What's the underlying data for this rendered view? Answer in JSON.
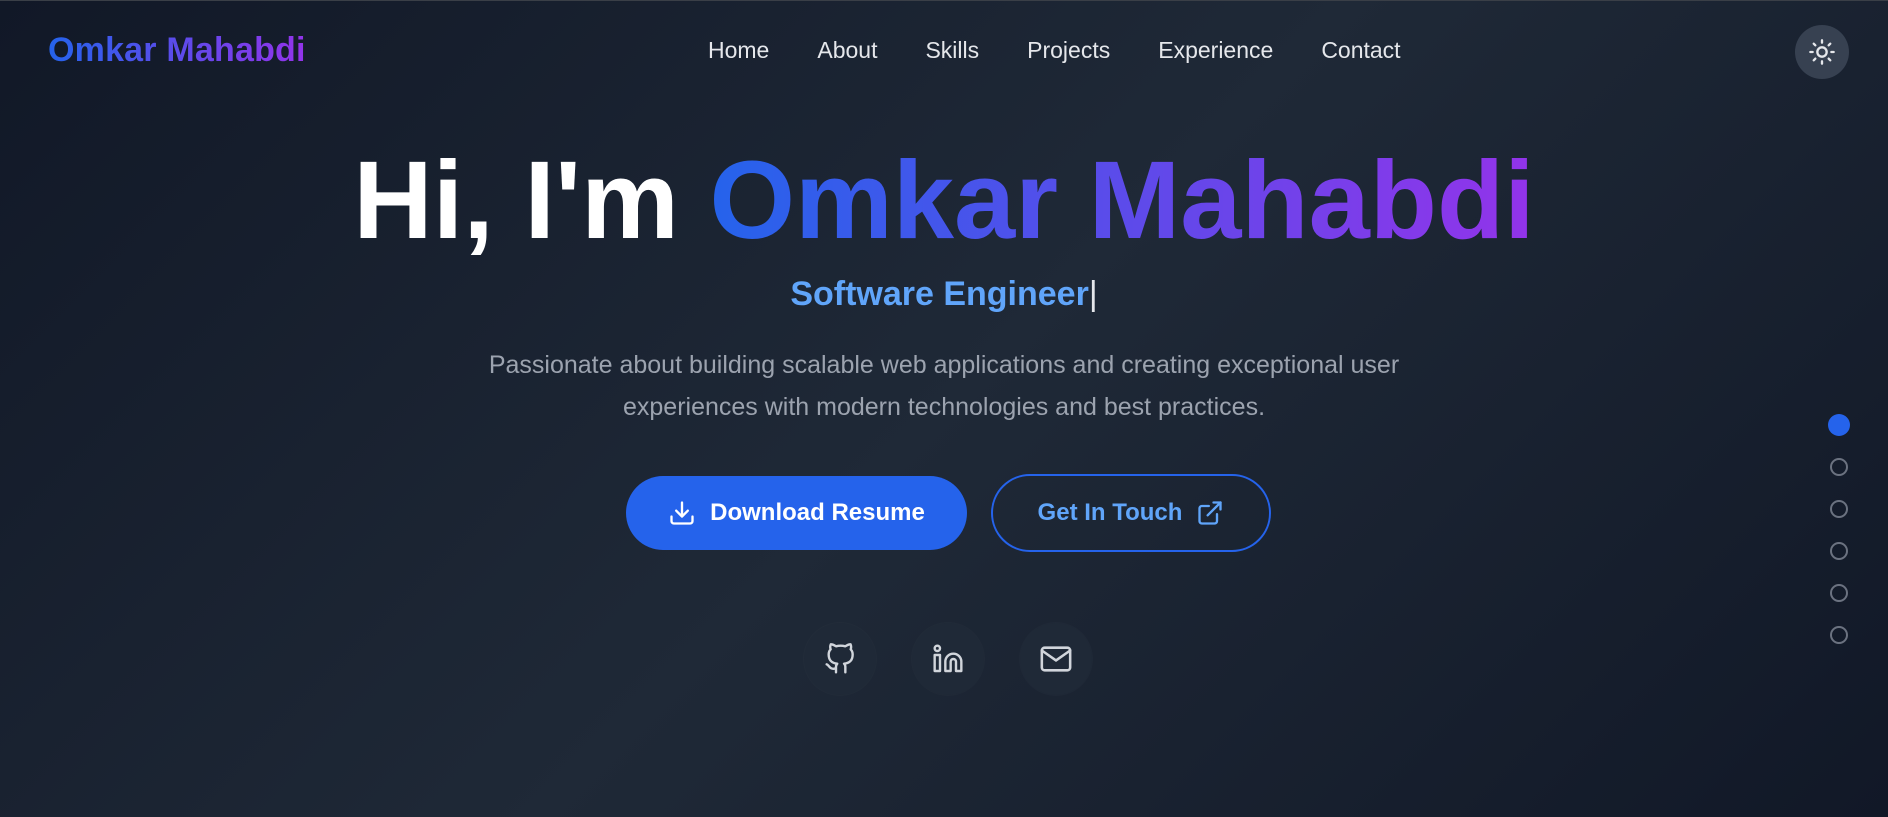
{
  "nav": {
    "brand": "Omkar Mahabdi",
    "links": [
      "Home",
      "About",
      "Skills",
      "Projects",
      "Experience",
      "Contact"
    ],
    "theme_toggle_icon": "sun-icon"
  },
  "hero": {
    "greeting": "Hi, I'm ",
    "name": "Omkar Mahabdi",
    "role": "Software Engineer",
    "cursor": "|",
    "description": "Passionate about building scalable web applications and creating exceptional user experiences with modern technologies and best practices."
  },
  "buttons": {
    "download_label": "Download Resume",
    "download_icon": "download-icon",
    "contact_label": "Get In Touch",
    "contact_icon": "external-link-icon"
  },
  "social": {
    "icons": [
      "github-icon",
      "linkedin-icon",
      "mail-icon"
    ]
  },
  "section_dots": {
    "count": 6,
    "active_index": 0
  },
  "colors": {
    "accent": "#2563eb",
    "accent_light": "#60a5fa",
    "gradient_end": "#9333ea",
    "background": "#111827"
  }
}
